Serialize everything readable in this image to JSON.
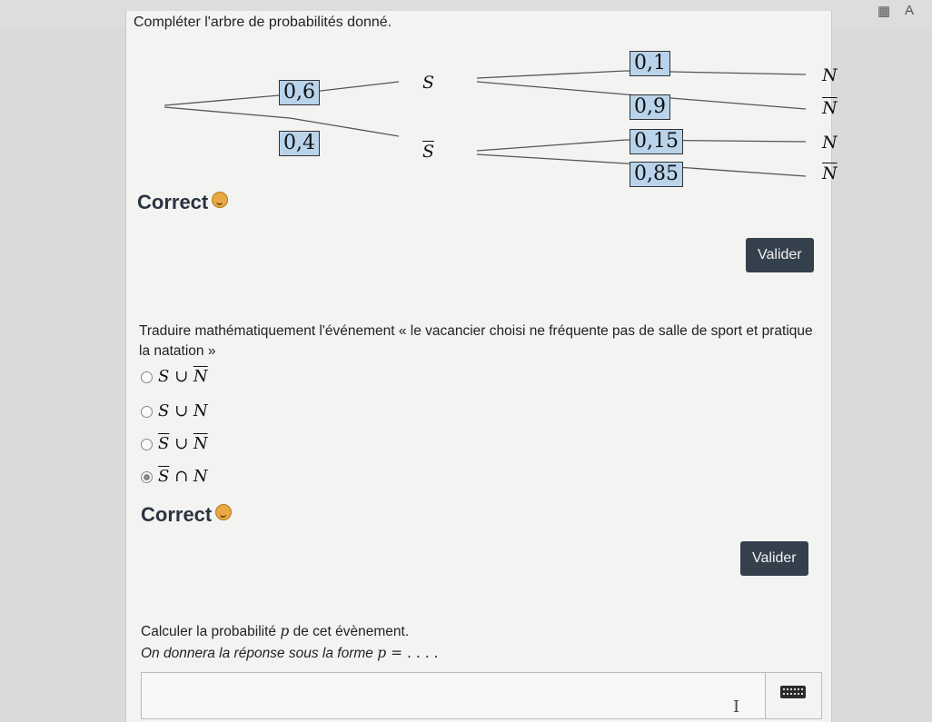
{
  "toolbar": {
    "reader_icon": "A",
    "reader_icon_name": "read-aloud-icon",
    "immersive_icon_name": "immersive-reader-icon"
  },
  "question1": {
    "title": "Compléter l'arbre de probabilités donné.",
    "tree": {
      "p_S": "0,6",
      "p_notS": "0,4",
      "label_S": "S",
      "label_notS": "S",
      "p_N_given_S": "0,1",
      "p_notN_given_S": "0,9",
      "p_N_given_notS": "0,15",
      "p_notN_given_notS": "0,85",
      "label_N": "N",
      "label_notN": "N"
    },
    "feedback": "Correct",
    "validate_label": "Valider"
  },
  "question2": {
    "prompt": "Traduire mathématiquement l'événement « le vacancier choisi ne fréquente pas de salle de sport et pratique la natation »",
    "choices": [
      {
        "a": "S",
        "op": "∪",
        "b": "N",
        "a_bar": false,
        "b_bar": true,
        "selected": false
      },
      {
        "a": "S",
        "op": "∪",
        "b": "N",
        "a_bar": false,
        "b_bar": false,
        "selected": false
      },
      {
        "a": "S",
        "op": "∪",
        "b": "N",
        "a_bar": true,
        "b_bar": true,
        "selected": false
      },
      {
        "a": "S",
        "op": "∩",
        "b": "N",
        "a_bar": true,
        "b_bar": false,
        "selected": true
      }
    ],
    "feedback": "Correct",
    "validate_label": "Valider"
  },
  "question3": {
    "prompt_before": "Calculer la probabilité ",
    "prompt_var": "p",
    "prompt_after": " de cet évènement.",
    "hint_before": "On donnera la réponse sous la forme ",
    "hint_math": "p = . . . .",
    "input_value": "",
    "keyboard_icon": "keyboard-icon"
  },
  "colors": {
    "box_fill": "#b8d3ea",
    "button_bg": "#34404c",
    "panel_bg": "#f3f4f2"
  }
}
